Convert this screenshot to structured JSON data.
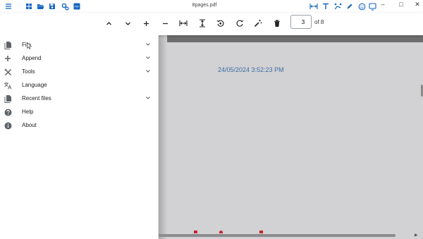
{
  "titlebar": {
    "title": "8pages.pdf",
    "left_icons": [
      "menu-icon",
      "grid-icon",
      "folder-open-icon",
      "save-icon",
      "settings-icon",
      "pdf-icon"
    ],
    "right_icons": [
      "fit-width-icon",
      "text-icon",
      "draw-icon",
      "pen-icon",
      "emoji-icon",
      "screen-icon"
    ],
    "window_controls": {
      "minimize": "–",
      "maximize": "□",
      "close": "✕"
    }
  },
  "toolbar": {
    "tools": [
      "previous-page-icon",
      "next-page-icon",
      "zoom-in-icon",
      "zoom-out-icon",
      "fit-width-icon",
      "fit-height-icon",
      "rotate-left-icon",
      "rotate-right-icon",
      "magic-wand-icon",
      "delete-icon"
    ],
    "page_value": "3",
    "page_of": "of 8"
  },
  "drawer": {
    "items": [
      {
        "label": "File",
        "icon": "file-icon",
        "expandable": true
      },
      {
        "label": "Append",
        "icon": "plus-icon",
        "expandable": true
      },
      {
        "label": "Tools",
        "icon": "tools-icon",
        "expandable": true
      },
      {
        "label": "Language",
        "icon": "translate-icon",
        "expandable": false
      },
      {
        "label": "Recent files",
        "icon": "file-icon",
        "expandable": true
      },
      {
        "label": "Help",
        "icon": "help-icon",
        "expandable": false
      },
      {
        "label": "About",
        "icon": "info-icon",
        "expandable": false
      }
    ]
  },
  "viewer": {
    "date_text": "24/05/2024 3:52:23 PM"
  },
  "colors": {
    "accent": "#1565c0",
    "viewer_bg": "#d2d1d3",
    "date_text": "#3d6fa6",
    "marker_red": "#c8262b"
  }
}
